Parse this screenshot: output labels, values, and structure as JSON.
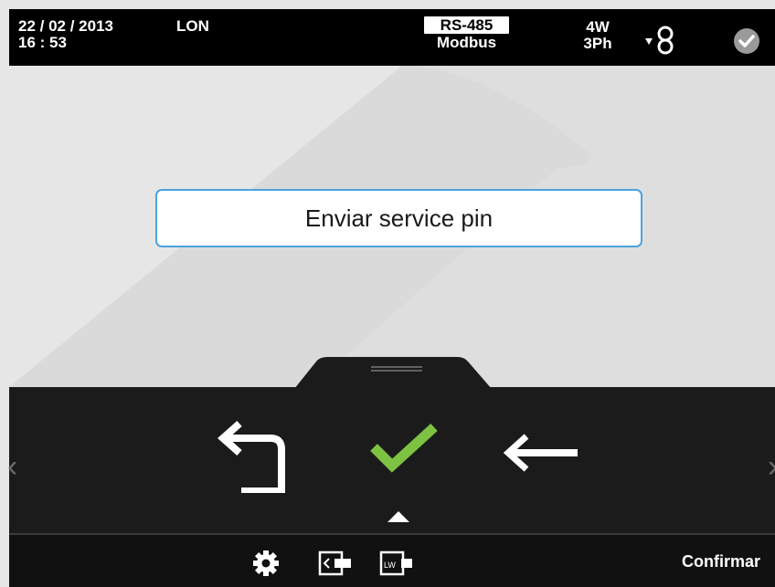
{
  "status_bar": {
    "date": "22 / 02 / 2013",
    "time": "16 : 53",
    "network": "LON",
    "comm_protocol": "RS-485",
    "comm_mode": "Modbus",
    "wiring_line1": "4W",
    "wiring_line2": "3Ph",
    "ct_icon": "current-transformer-icon",
    "status_icon": "check-circle-icon"
  },
  "main": {
    "option_text": "Enviar service pin"
  },
  "actions": {
    "back_icon": "return-arrow-icon",
    "confirm_icon": "check-icon",
    "delete_icon": "left-arrow-icon",
    "accent_color": "#7dc242"
  },
  "toolbar": {
    "icons": [
      "gear-icon",
      "exit-icon",
      "lw-icon"
    ],
    "action_label": "Confirmar"
  },
  "colors": {
    "field_border": "#4aa3df",
    "bar_background": "#000000"
  }
}
